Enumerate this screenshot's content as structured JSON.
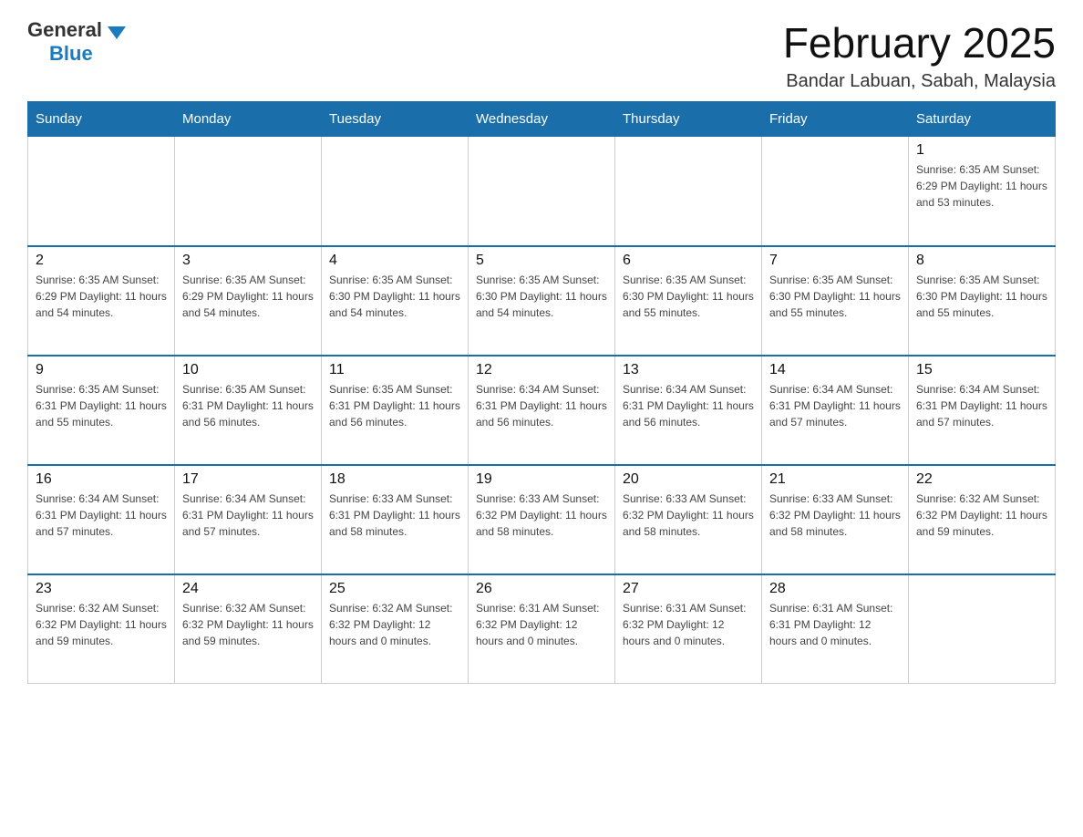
{
  "header": {
    "logo_general": "General",
    "logo_blue": "Blue",
    "month_title": "February 2025",
    "location": "Bandar Labuan, Sabah, Malaysia"
  },
  "days_of_week": [
    "Sunday",
    "Monday",
    "Tuesday",
    "Wednesday",
    "Thursday",
    "Friday",
    "Saturday"
  ],
  "weeks": [
    [
      {
        "day": "",
        "info": ""
      },
      {
        "day": "",
        "info": ""
      },
      {
        "day": "",
        "info": ""
      },
      {
        "day": "",
        "info": ""
      },
      {
        "day": "",
        "info": ""
      },
      {
        "day": "",
        "info": ""
      },
      {
        "day": "1",
        "info": "Sunrise: 6:35 AM\nSunset: 6:29 PM\nDaylight: 11 hours\nand 53 minutes."
      }
    ],
    [
      {
        "day": "2",
        "info": "Sunrise: 6:35 AM\nSunset: 6:29 PM\nDaylight: 11 hours\nand 54 minutes."
      },
      {
        "day": "3",
        "info": "Sunrise: 6:35 AM\nSunset: 6:29 PM\nDaylight: 11 hours\nand 54 minutes."
      },
      {
        "day": "4",
        "info": "Sunrise: 6:35 AM\nSunset: 6:30 PM\nDaylight: 11 hours\nand 54 minutes."
      },
      {
        "day": "5",
        "info": "Sunrise: 6:35 AM\nSunset: 6:30 PM\nDaylight: 11 hours\nand 54 minutes."
      },
      {
        "day": "6",
        "info": "Sunrise: 6:35 AM\nSunset: 6:30 PM\nDaylight: 11 hours\nand 55 minutes."
      },
      {
        "day": "7",
        "info": "Sunrise: 6:35 AM\nSunset: 6:30 PM\nDaylight: 11 hours\nand 55 minutes."
      },
      {
        "day": "8",
        "info": "Sunrise: 6:35 AM\nSunset: 6:30 PM\nDaylight: 11 hours\nand 55 minutes."
      }
    ],
    [
      {
        "day": "9",
        "info": "Sunrise: 6:35 AM\nSunset: 6:31 PM\nDaylight: 11 hours\nand 55 minutes."
      },
      {
        "day": "10",
        "info": "Sunrise: 6:35 AM\nSunset: 6:31 PM\nDaylight: 11 hours\nand 56 minutes."
      },
      {
        "day": "11",
        "info": "Sunrise: 6:35 AM\nSunset: 6:31 PM\nDaylight: 11 hours\nand 56 minutes."
      },
      {
        "day": "12",
        "info": "Sunrise: 6:34 AM\nSunset: 6:31 PM\nDaylight: 11 hours\nand 56 minutes."
      },
      {
        "day": "13",
        "info": "Sunrise: 6:34 AM\nSunset: 6:31 PM\nDaylight: 11 hours\nand 56 minutes."
      },
      {
        "day": "14",
        "info": "Sunrise: 6:34 AM\nSunset: 6:31 PM\nDaylight: 11 hours\nand 57 minutes."
      },
      {
        "day": "15",
        "info": "Sunrise: 6:34 AM\nSunset: 6:31 PM\nDaylight: 11 hours\nand 57 minutes."
      }
    ],
    [
      {
        "day": "16",
        "info": "Sunrise: 6:34 AM\nSunset: 6:31 PM\nDaylight: 11 hours\nand 57 minutes."
      },
      {
        "day": "17",
        "info": "Sunrise: 6:34 AM\nSunset: 6:31 PM\nDaylight: 11 hours\nand 57 minutes."
      },
      {
        "day": "18",
        "info": "Sunrise: 6:33 AM\nSunset: 6:31 PM\nDaylight: 11 hours\nand 58 minutes."
      },
      {
        "day": "19",
        "info": "Sunrise: 6:33 AM\nSunset: 6:32 PM\nDaylight: 11 hours\nand 58 minutes."
      },
      {
        "day": "20",
        "info": "Sunrise: 6:33 AM\nSunset: 6:32 PM\nDaylight: 11 hours\nand 58 minutes."
      },
      {
        "day": "21",
        "info": "Sunrise: 6:33 AM\nSunset: 6:32 PM\nDaylight: 11 hours\nand 58 minutes."
      },
      {
        "day": "22",
        "info": "Sunrise: 6:32 AM\nSunset: 6:32 PM\nDaylight: 11 hours\nand 59 minutes."
      }
    ],
    [
      {
        "day": "23",
        "info": "Sunrise: 6:32 AM\nSunset: 6:32 PM\nDaylight: 11 hours\nand 59 minutes."
      },
      {
        "day": "24",
        "info": "Sunrise: 6:32 AM\nSunset: 6:32 PM\nDaylight: 11 hours\nand 59 minutes."
      },
      {
        "day": "25",
        "info": "Sunrise: 6:32 AM\nSunset: 6:32 PM\nDaylight: 12 hours\nand 0 minutes."
      },
      {
        "day": "26",
        "info": "Sunrise: 6:31 AM\nSunset: 6:32 PM\nDaylight: 12 hours\nand 0 minutes."
      },
      {
        "day": "27",
        "info": "Sunrise: 6:31 AM\nSunset: 6:32 PM\nDaylight: 12 hours\nand 0 minutes."
      },
      {
        "day": "28",
        "info": "Sunrise: 6:31 AM\nSunset: 6:31 PM\nDaylight: 12 hours\nand 0 minutes."
      },
      {
        "day": "",
        "info": ""
      }
    ]
  ]
}
